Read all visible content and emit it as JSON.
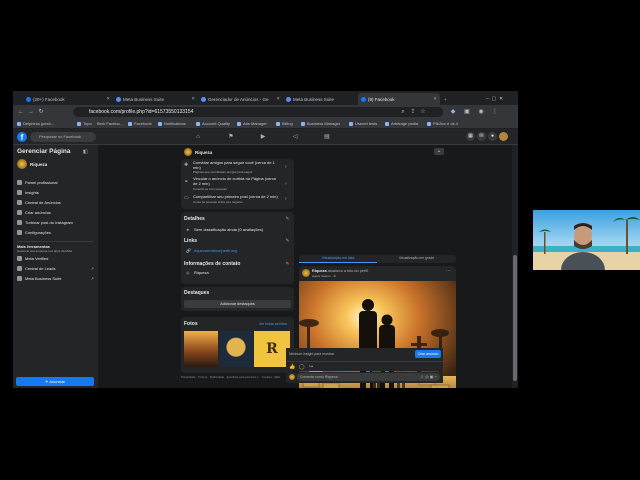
{
  "tabs": [
    {
      "label": "(20+) Facebook"
    },
    {
      "label": "Meta Business Suite"
    },
    {
      "label": "Gerenciador de Anúncios - Ge"
    },
    {
      "label": "Meta Business Suite"
    },
    {
      "label": "(9) Facebook"
    }
  ],
  "address": {
    "url": "facebook.com/profile.php?id=61573550133154"
  },
  "bookmarks": [
    "Delphinia (pesh...",
    "Topo",
    "Berk Facebo...",
    "Facebook",
    "Notifications",
    "Account Quality",
    "Ads Manager",
    "Billing",
    "Business Manager",
    "Usenet tests",
    "Arbitrage pedia",
    "FB/Acc é ok 4"
  ],
  "fb": {
    "search_placeholder": "Pesquisar no Facebook"
  },
  "sidebar": {
    "title": "Gerenciar Página",
    "page_name": "Riqueza",
    "items": [
      {
        "label": "Painel profissional"
      },
      {
        "label": "Insights"
      },
      {
        "label": "Central de Anúncios"
      },
      {
        "label": "Criar anúncios"
      },
      {
        "label": "Turbinar post do Instagram"
      },
      {
        "label": "Configurações"
      }
    ],
    "more_tools_label": "Mais ferramentas",
    "more_tools_sub": "Gerencie sua empresa nos apps da Meta",
    "tools": [
      {
        "label": "Meta Verified"
      },
      {
        "label": "Central de Leads"
      },
      {
        "label": "Meta Business Suite"
      }
    ],
    "advertise_button": "Anunciar"
  },
  "left": {
    "page_name": "Riqueza",
    "checklist": [
      {
        "title": "Convidar amigos para seguir você (cerca de 1 min)",
        "sub": "Páginas que convidaram amigos para seguir"
      },
      {
        "title": "Vincular o anúncio de curtida na Página (cerca de 2 min)",
        "sub": "Conecte-se com pessoas"
      },
      {
        "title": "Compartilhar seu primeiro post (cerca de 2 min)",
        "sub": "Conte às pessoas sobre seu negócio"
      }
    ],
    "details_title": "Detalhes",
    "details_rating": "Sem classificação ainda (0 avaliações)",
    "links_title": "Links",
    "links_url": "riquezaemfoco/perfil.org",
    "contact_title": "Informações de contato",
    "contact_name": "Riqueza",
    "highlights_title": "Destaques",
    "highlights_button": "Adicionar destaques",
    "photos_title": "Fotos",
    "photos_link": "Ver todas as fotos",
    "footer": "Privacidade · Termos · Publicidade · Escolhas para anúncios ▷ · Cookies · Mais"
  },
  "post": {
    "tab_feed": "Visualização em lista",
    "tab_grid": "Visualização em grade",
    "author": "Riqueza",
    "action": "atualizou a foto do perfil.",
    "time": "Agora mesmo · ⊕",
    "insights": "Nenhum insight para mostrar",
    "boost_button": "Criar anúncio",
    "comment_placeholder": "Comente como Riqueza"
  },
  "colors": {
    "accent": "#1877f2",
    "bg": "#18191a",
    "card": "#242526"
  }
}
